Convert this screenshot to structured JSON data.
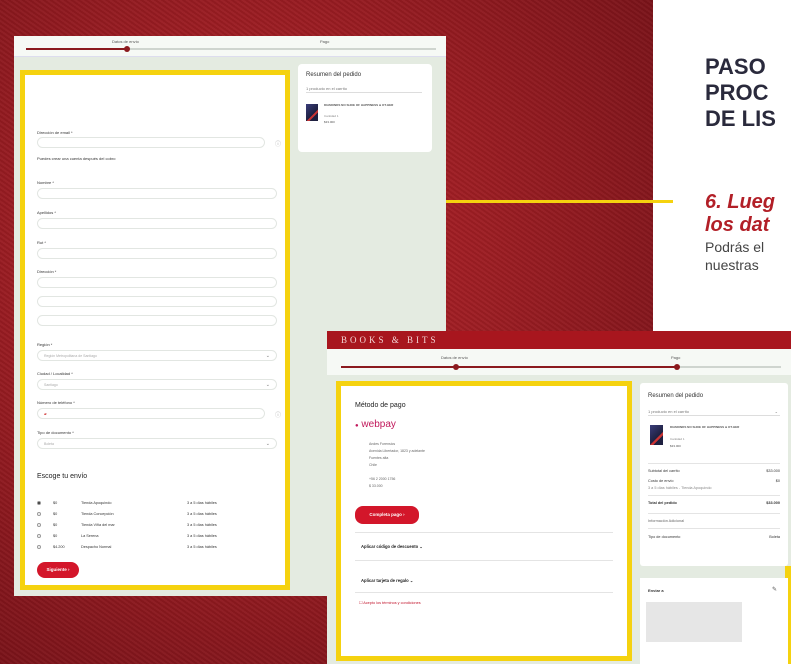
{
  "heading": {
    "title_lines": [
      "PASO",
      "PROC",
      "DE LIS"
    ],
    "subtitle_lines": [
      "6. Lueg",
      "los dat"
    ],
    "desc_lines": [
      "Podrás el",
      "nuestras "
    ]
  },
  "checkout_form": {
    "steps": [
      "Datos de envío",
      "Pago"
    ],
    "fields": {
      "email_label": "Dirección de email *",
      "account_note": "Puedes crear una cuenta después del cobro",
      "name_label": "Nombre *",
      "lastname_label": "Apellidos *",
      "rut_label": "Rut *",
      "address_label": "Dirección *",
      "region_label": "Región *",
      "region_placeholder": "Región Metropolitana de Santiago",
      "city_label": "Ciudad / Localidad *",
      "city_placeholder": "Santiago",
      "phone_label": "Número de teléfono *",
      "doc_label": "Tipo de documento *",
      "doc_value": "Boleta"
    },
    "shipping_title": "Escoge tu envío",
    "shipping_options": [
      {
        "price": "$0",
        "name": "Tienda Apoquindo",
        "days": "3 a 5 días hábiles"
      },
      {
        "price": "$0",
        "name": "Tienda Concepción",
        "days": "3 a 5 días hábiles"
      },
      {
        "price": "$0",
        "name": "Tienda Viña del mar",
        "days": "3 a 5 días hábiles"
      },
      {
        "price": "$0",
        "name": "La Serena",
        "days": "3 a 5 días hábiles"
      },
      {
        "price": "$4.200",
        "name": "Despacho Normal",
        "days": "3 a 5 días hábiles"
      }
    ],
    "next_button": "Siguiente"
  },
  "summary1": {
    "title": "Resumen del pedido",
    "toggle": "1 producto en el carrito",
    "product_name": "DIAMONDS NO SHOE OF HAPPINESS & OT-HER",
    "qty": "Cantidad 1",
    "price": "$33.000"
  },
  "payment": {
    "brand": "BOOKS & BITS",
    "steps": [
      "Datos de envío",
      "Pago"
    ],
    "method_title": "Método de pago",
    "webpay": "webpay",
    "merchant_lines": [
      "Andes Forensics",
      "Avenida Libertador, 1823 y adelante",
      "Fuentes alta",
      "Chile",
      "+56 2 2000 1756",
      "$ 33.000"
    ],
    "pay_button": "Completa pago",
    "coupon": "Aplicar código de descuento",
    "giftcard": "Aplicar tarjeta de regalo",
    "terms": "Acepto los términos y condiciones"
  },
  "summary2": {
    "title": "Resumen del pedido",
    "toggle": "1 producto en el carrito",
    "product_name": "DIAMONDS NO SHOE OF HAPPINESS & OT-HER",
    "qty": "Cantidad 1",
    "price": "$33.000",
    "subtotal_label": "Subtotal del carrito",
    "subtotal_value": "$33.000",
    "shipping_label": "Costo de envío",
    "shipping_value": "$0",
    "shipping_note": "3 a 5 días hábiles - Tienda Apoquindo",
    "total_label": "Total del pedido",
    "total_value": "$33.000",
    "extra_label": "Información Adicional",
    "doc_label": "Tipo de documento",
    "doc_value": "Boleta"
  },
  "envio": {
    "label": "Enviar a"
  },
  "colors": {
    "accent_red": "#d3162a",
    "highlight_yellow": "#f5d20f",
    "brand_bar": "#a8161e"
  }
}
